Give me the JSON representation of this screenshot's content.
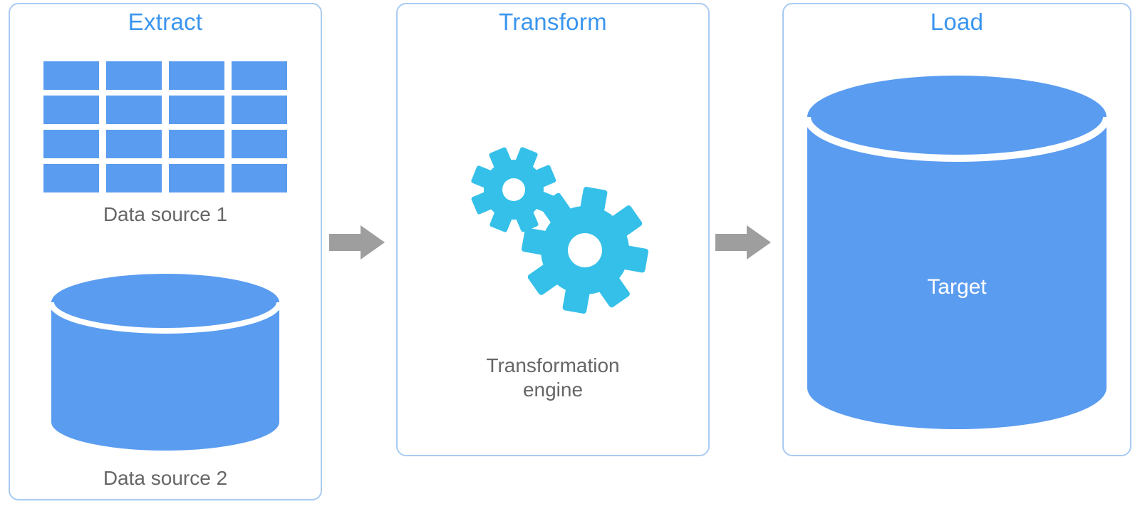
{
  "colors": {
    "stage_border": "#a9cbf2",
    "title_blue": "#3a95ee",
    "fill_blue": "#5a9cf0",
    "gear_cyan": "#34c0e8",
    "arrow_gray": "#9e9e9e",
    "caption_gray": "#666666"
  },
  "stages": {
    "extract": {
      "title": "Extract",
      "data_source_1_label": "Data source 1",
      "data_source_2_label": "Data source 2"
    },
    "transform": {
      "title": "Transform",
      "engine_label_line1": "Transformation",
      "engine_label_line2": "engine"
    },
    "load": {
      "title": "Load",
      "target_label": "Target"
    }
  }
}
